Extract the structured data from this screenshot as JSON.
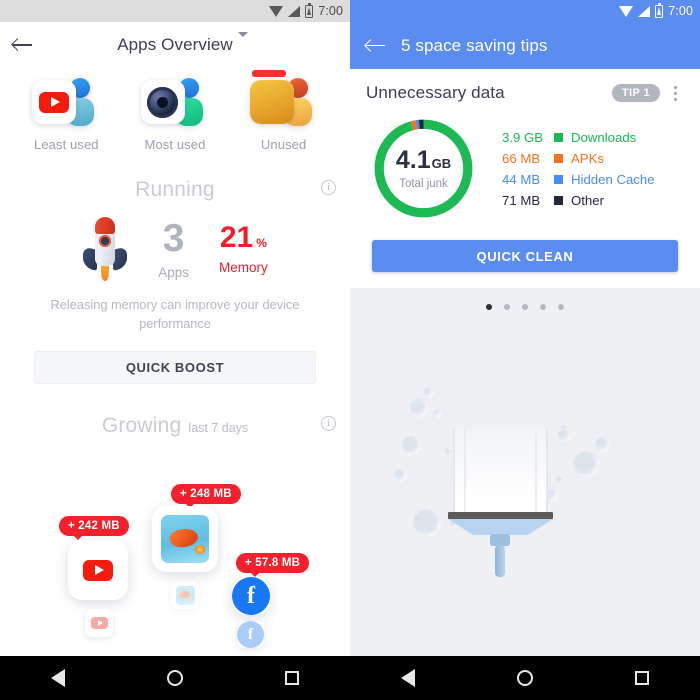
{
  "status_bar": {
    "time": "7:00",
    "icons": [
      "wifi-icon",
      "signal-icon",
      "battery-charging-icon"
    ]
  },
  "left_panel": {
    "appbar": {
      "back_icon": "arrow-left-icon",
      "title": "Apps Overview",
      "dropdown_icon": "chevron-down-icon"
    },
    "usage_categories": [
      {
        "label": "Least used",
        "badge": false
      },
      {
        "label": "Most used",
        "badge": false
      },
      {
        "label": "Unused",
        "badge": true
      }
    ],
    "running": {
      "title": "Running",
      "info_icon": "info-icon",
      "apps_count": "3",
      "apps_caption": "Apps",
      "memory_value": "21",
      "memory_unit": "%",
      "memory_caption": "Memory",
      "description": "Releasing memory can improve your device performance",
      "button_label": "QUICK BOOST",
      "accent_color": "#f01e2c"
    },
    "growing": {
      "title": "Growing",
      "subtitle": "last 7 days",
      "info_icon": "info-icon",
      "badge_color": "#f4212c",
      "apps": [
        {
          "name": "youtube",
          "delta": "+ 242 MB"
        },
        {
          "name": "dragon-game",
          "delta": "+ 248 MB"
        },
        {
          "name": "facebook",
          "delta": "+ 57.8 MB"
        }
      ]
    }
  },
  "right_panel": {
    "appbar": {
      "back_icon": "arrow-left-icon",
      "title": "5 space saving tips",
      "color": "#5b8cf0"
    },
    "card": {
      "title": "Unnecessary data",
      "tip_badge": "TIP 1",
      "overflow_icon": "kebab-menu-icon",
      "button_label": "QUICK CLEAN"
    },
    "pager": {
      "total": 5,
      "active_index": 0
    },
    "illustration": "squeegee-cleaning-icon"
  },
  "chart_data": {
    "type": "pie",
    "title": "Total junk",
    "center_value": "4.1",
    "center_unit": "GB",
    "center_caption": "Total junk",
    "total_bytes_label": "4.1 GB",
    "categories": [
      "Downloads",
      "APKs",
      "Hidden Cache",
      "Other"
    ],
    "value_labels": [
      "3.9 GB",
      "66 MB",
      "44 MB",
      "71 MB"
    ],
    "values_mb": [
      3993.6,
      66,
      44,
      71
    ],
    "colors": [
      "#1db954",
      "#f4731e",
      "#4a8df0",
      "#23293d"
    ],
    "legend_position": "right",
    "donut": true
  },
  "nav_bar": {
    "items": [
      "back-nav-icon",
      "home-nav-icon",
      "recents-nav-icon"
    ]
  }
}
